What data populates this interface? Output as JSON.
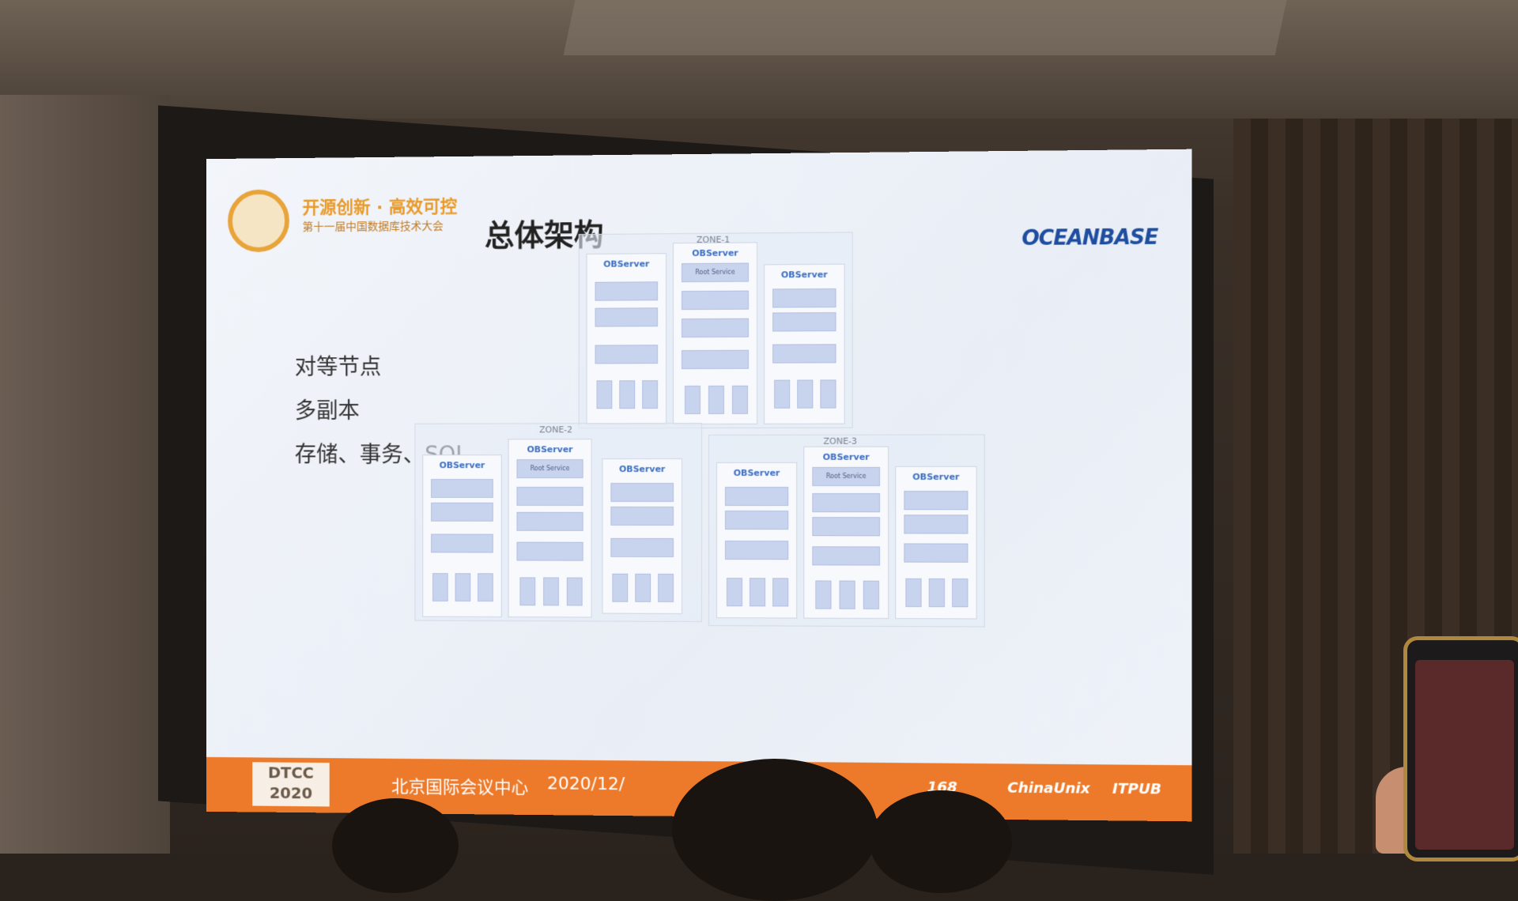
{
  "slide": {
    "conference_logo_line1": "开源创新 · 高效可控",
    "conference_logo_line2": "第十一届中国数据库技术大会",
    "title": "总体架构",
    "brand": "OCEANBASE",
    "bullets": [
      "对等节点",
      "多副本",
      "存储、事务、SQL"
    ],
    "zones": [
      {
        "label": "ZONE-1"
      },
      {
        "label": "ZONE-2"
      },
      {
        "label": "ZONE-3"
      }
    ],
    "observer_label": "OBServer",
    "root_service_label": "Root Service",
    "footer": {
      "logo_line1": "DTCC",
      "logo_line2": "2020",
      "venue": "北京国际会议中心",
      "date": "2020/12/",
      "sponsors": [
        "168",
        "ChinaUnix",
        "ITPUB"
      ]
    }
  }
}
